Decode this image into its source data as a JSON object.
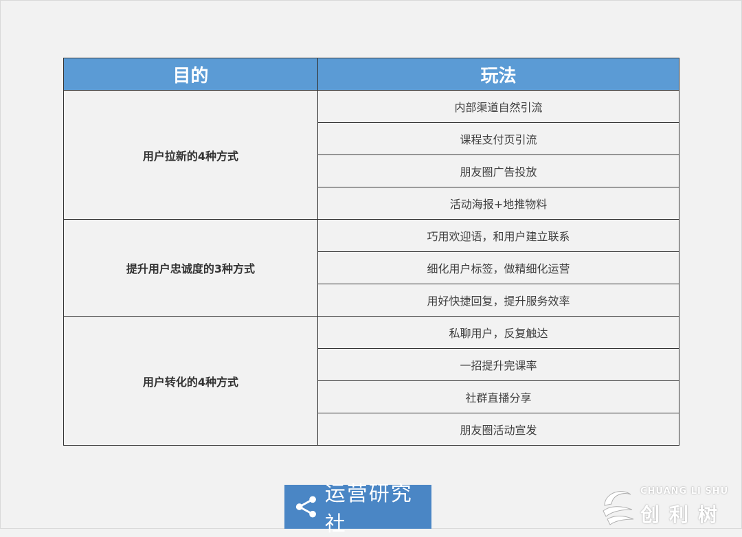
{
  "table": {
    "headers": {
      "purpose": "目的",
      "method": "玩法"
    },
    "groups": [
      {
        "purpose": "用户拉新的4种方式",
        "methods": [
          "内部渠道自然引流",
          "课程支付页引流",
          "朋友圈广告投放",
          "活动海报+地推物料"
        ]
      },
      {
        "purpose": "提升用户忠诚度的3种方式",
        "methods": [
          "巧用欢迎语，和用户建立联系",
          "细化用户标签，做精细化运营",
          "用好快捷回复，提升服务效率"
        ]
      },
      {
        "purpose": "用户转化的4种方式",
        "methods": [
          "私聊用户，反复触达",
          "一招提升完课率",
          "社群直播分享",
          "朋友圈活动宣发"
        ]
      }
    ]
  },
  "footer": {
    "logo_text": "运营研究社",
    "logo_icon": "share-icon",
    "brand_latin": "CHUANG LI SHU",
    "brand_cn": "创利树"
  },
  "colors": {
    "header_bg": "#5b9bd5",
    "logo_bg": "#4a86c5",
    "page_bg": "#f2f2f2"
  }
}
